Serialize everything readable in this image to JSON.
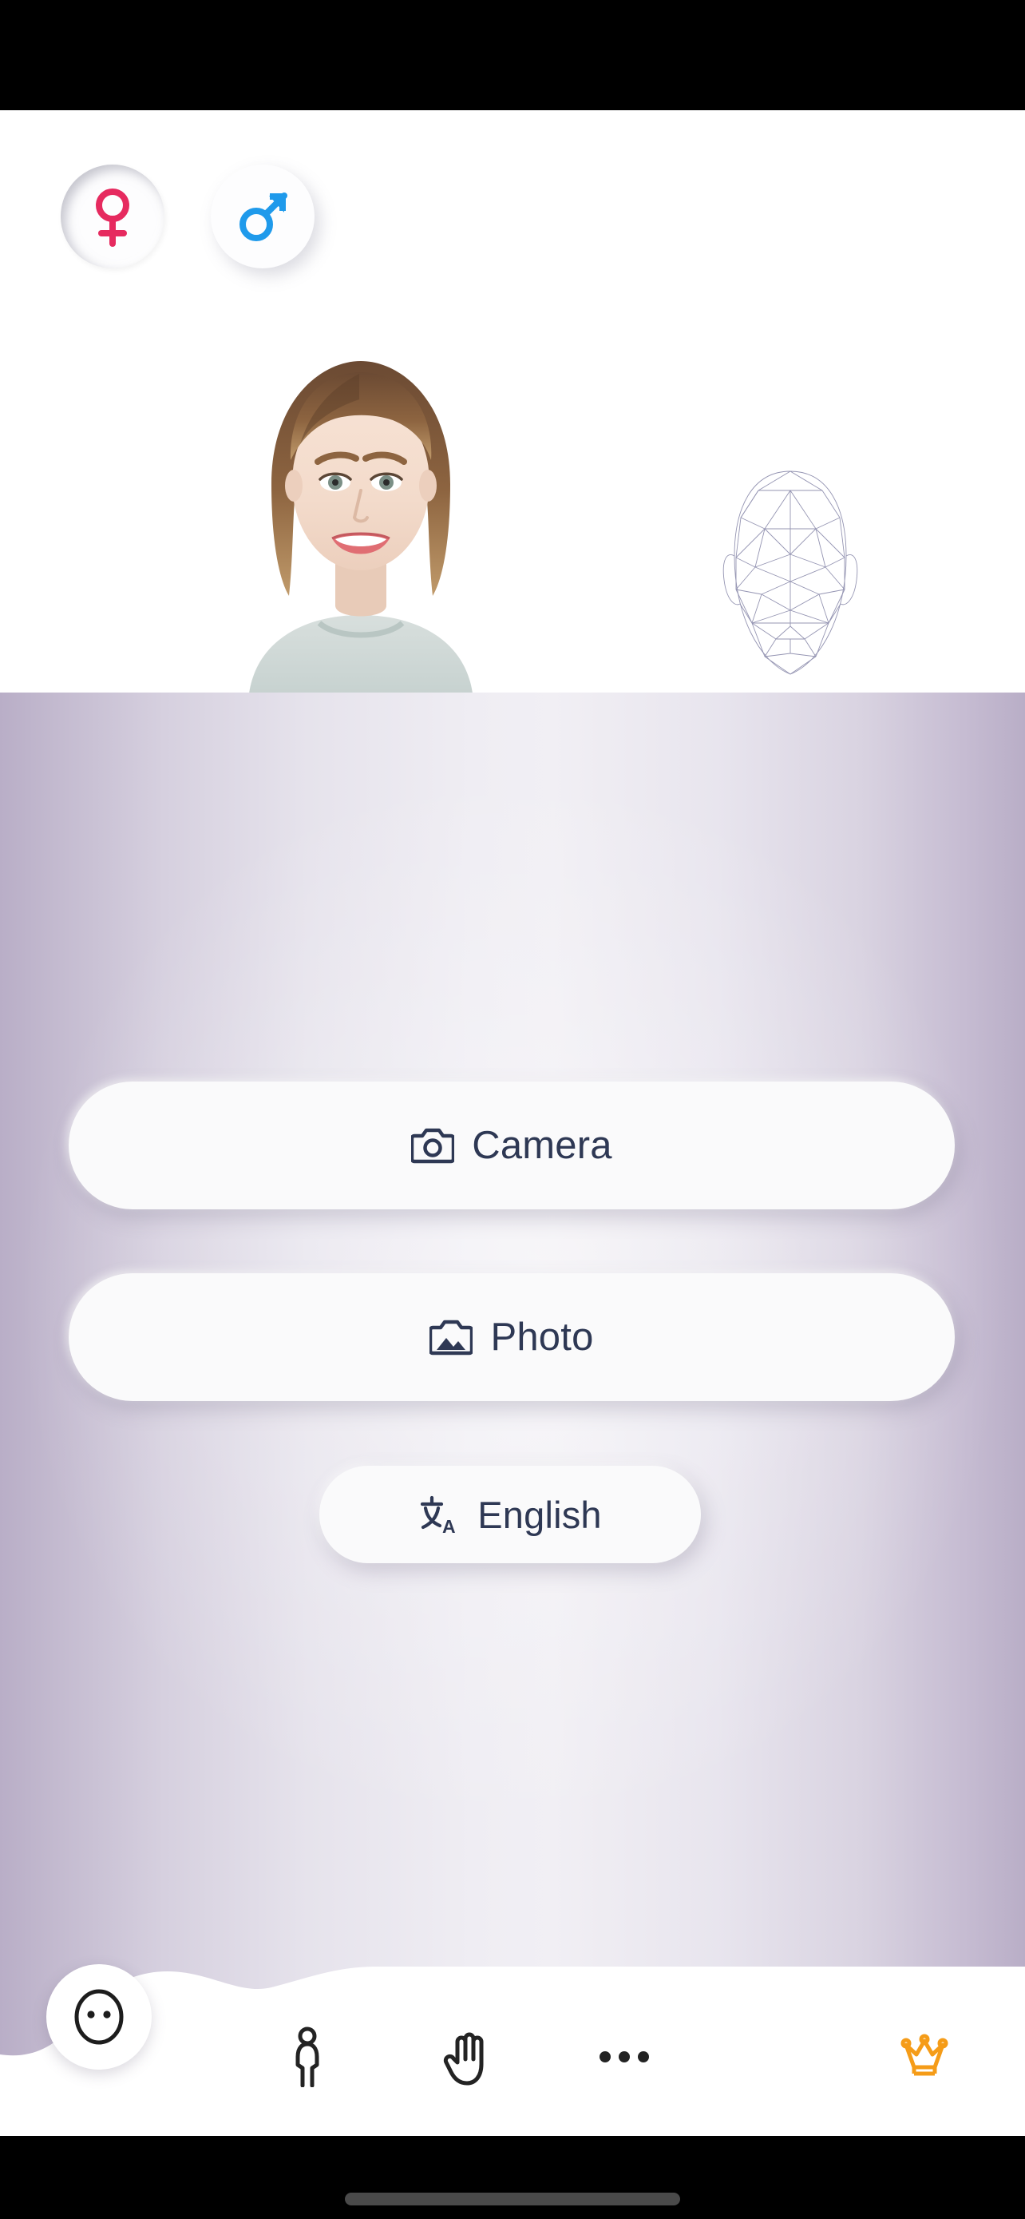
{
  "app": {
    "screen_name": "face-analysis-home"
  },
  "gender_selector": {
    "options": [
      {
        "id": "female",
        "icon": "female-gender-icon",
        "color": "#e8२",
        "selected": true
      },
      {
        "id": "male",
        "icon": "male-gender-icon",
        "selected": false
      }
    ],
    "female_color": "#e62a5f",
    "male_color": "#1f9aeb"
  },
  "hero": {
    "portrait_alt": "smiling-woman-portrait",
    "facemesh_alt": "face-mesh-wireframe",
    "mesh_color": "#8f8fae"
  },
  "actions": {
    "camera": {
      "label": "Camera",
      "icon": "camera-icon"
    },
    "photo": {
      "label": "Photo",
      "icon": "photo-icon"
    },
    "language": {
      "label": "English",
      "icon": "translate-icon"
    }
  },
  "bottom_nav": {
    "fab": {
      "icon": "face-icon"
    },
    "items": [
      {
        "id": "person",
        "icon": "person-icon",
        "color": "#232323"
      },
      {
        "id": "hand",
        "icon": "hand-icon",
        "color": "#232323"
      },
      {
        "id": "more",
        "icon": "more-dots-icon",
        "color": "#232323"
      },
      {
        "id": "crown",
        "icon": "crown-icon",
        "color": "#f59c18"
      }
    ]
  },
  "colors": {
    "text_dark": "#2e3854",
    "panel_edge": "#b9aec7",
    "panel_center": "#f1eff4",
    "button_bg": "#fafafb",
    "crown_orange": "#f59c18",
    "nav_white": "#ffffff"
  },
  "system": {
    "home_indicator": "home-indicator"
  }
}
